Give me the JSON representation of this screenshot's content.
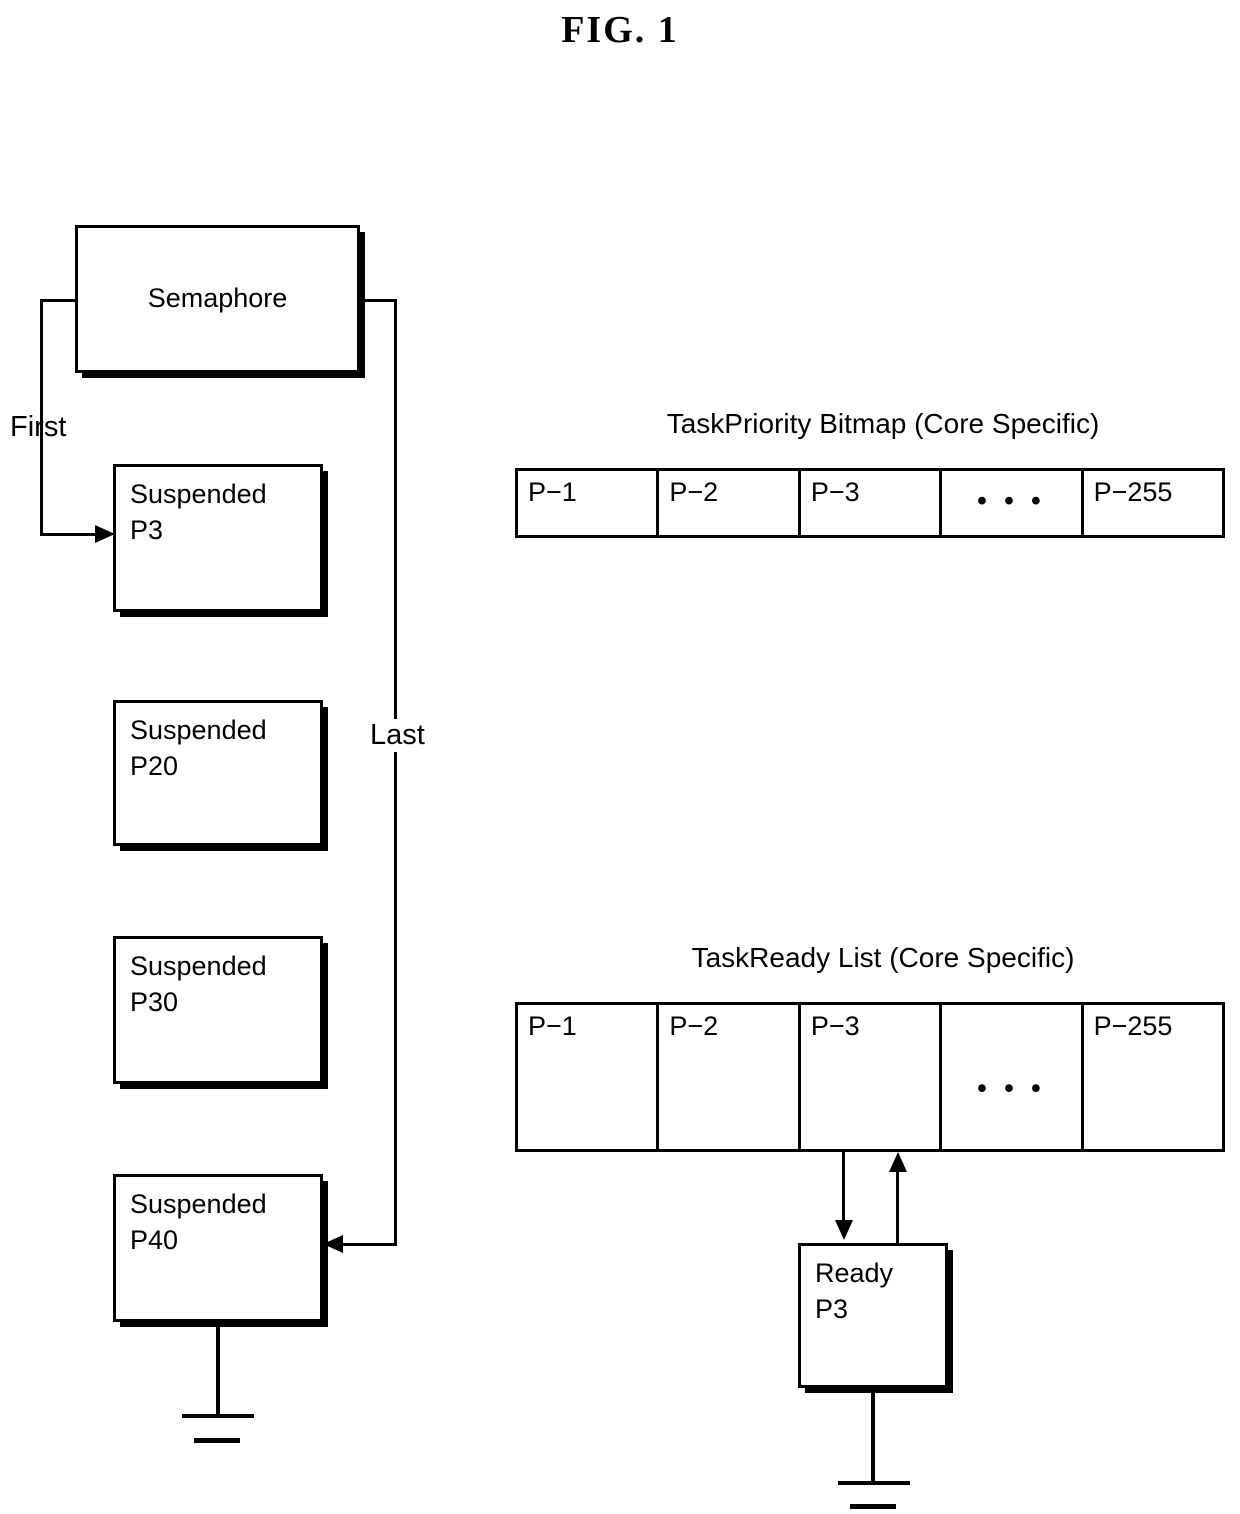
{
  "figure": {
    "title": "FIG.  1"
  },
  "semaphore": {
    "label": "Semaphore"
  },
  "queue": {
    "first_edge_label": "First",
    "last_edge_label": "Last",
    "nodes": [
      {
        "label": "Suspended\nP3"
      },
      {
        "label": "Suspended\nP20"
      },
      {
        "label": "Suspended\nP30"
      },
      {
        "label": "Suspended\nP40"
      }
    ]
  },
  "bitmap": {
    "caption": "TaskPriority Bitmap (Core Specific)",
    "cells": [
      "P−1",
      "P−2",
      "P−3",
      "• • •",
      "P−255"
    ]
  },
  "readylist": {
    "caption": "TaskReady List (Core Specific)",
    "cells": [
      "P−1",
      "P−2",
      "P−3",
      "• • •",
      "P−255"
    ]
  },
  "ready_task": {
    "label": "Ready\nP3"
  },
  "colors": {
    "stroke": "#000000",
    "background": "#ffffff"
  }
}
